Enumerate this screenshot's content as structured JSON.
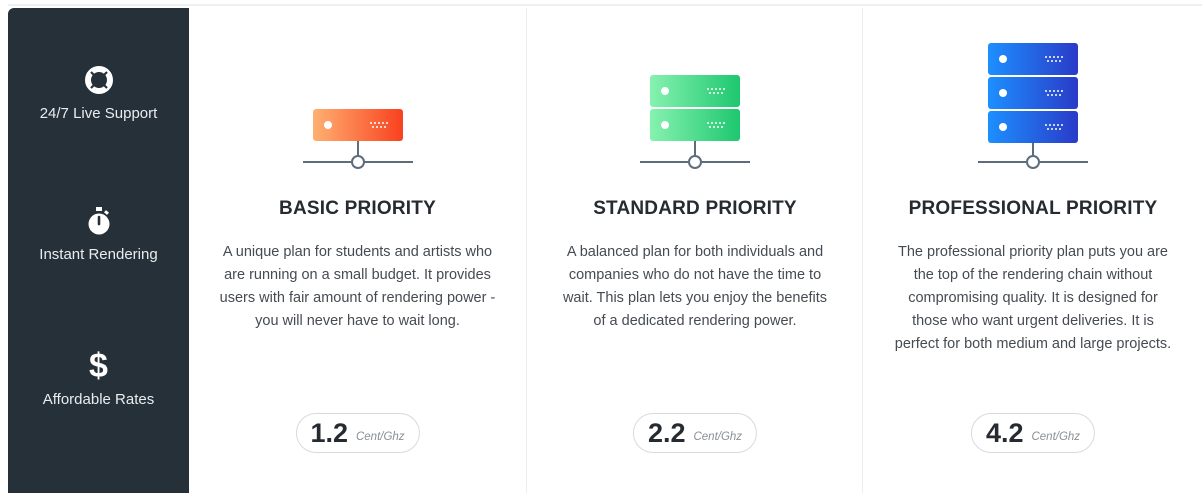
{
  "sidebar": {
    "features": [
      {
        "icon": "lifebuoy-icon",
        "label": "24/7 Live Support"
      },
      {
        "icon": "stopwatch-icon",
        "label": "Instant Rendering"
      },
      {
        "icon": "dollar-icon",
        "glyph": "$",
        "label": "Affordable Rates"
      }
    ]
  },
  "plans": [
    {
      "title": "BASIC PRIORITY",
      "description": "A unique plan for students and artists who are running on a small budget. It provides users with fair amount of rendering power - you will never have to wait long.",
      "price": "1.2",
      "unit": "Cent/Ghz",
      "icon": "server-single-icon",
      "color_start": "#ffb072",
      "color_end": "#f9411f"
    },
    {
      "title": "STANDARD PRIORITY",
      "description": "A balanced plan for both individuals and companies who do not have the time to wait. This plan lets you enjoy the benefits of a dedicated rendering power.",
      "price": "2.2",
      "unit": "Cent/Ghz",
      "icon": "server-double-icon",
      "color_start": "#86f2b0",
      "color_end": "#1ec76f"
    },
    {
      "title": "PROFESSIONAL PRIORITY",
      "description": "The professional priority plan puts you are the top of the rendering chain without compromising quality. It is designed for those who want urgent deliveries. It is perfect for both medium and large projects.",
      "price": "4.2",
      "unit": "Cent/Ghz",
      "icon": "server-triple-icon",
      "color_start": "#1d8fff",
      "color_end": "#2a3bc8"
    }
  ],
  "colors": {
    "sidebar_bg": "#253038",
    "network_line": "#5d6d7c"
  }
}
